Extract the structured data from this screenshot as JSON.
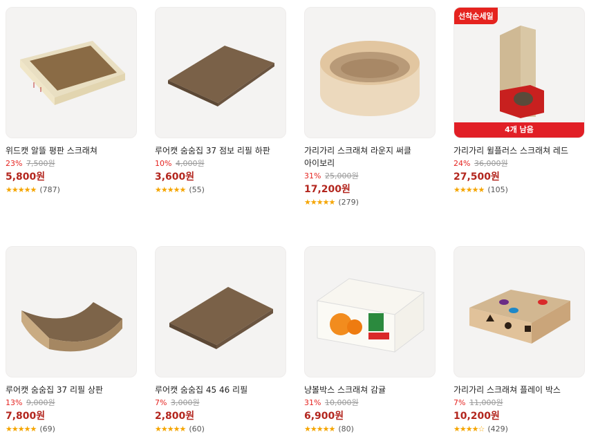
{
  "products": [
    {
      "name": "위드캣 알뜰 평판 스크래쳐",
      "discount": "23%",
      "original_price": "7,500원",
      "price": "5,800원",
      "stars": "★★★★★",
      "reviews": "(787)",
      "rating": 5.0
    },
    {
      "name": "루어캣 숨숨집 37 점보 리필 하판",
      "discount": "10%",
      "original_price": "4,000원",
      "price": "3,600원",
      "stars": "★★★★★",
      "reviews": "(55)",
      "rating": 5.0
    },
    {
      "name": "가리가리 스크래쳐 라운지 써클 아이보리",
      "discount": "31%",
      "original_price": "25,000원",
      "price": "17,200원",
      "stars": "★★★★★",
      "reviews": "(279)",
      "rating": 5.0
    },
    {
      "name": "가리가리 윌플러스 스크래쳐 레드",
      "discount": "24%",
      "original_price": "36,000원",
      "price": "27,500원",
      "stars": "★★★★★",
      "reviews": "(105)",
      "rating": 5.0,
      "badge": "선착순세일",
      "stock": "4개 남음"
    },
    {
      "name": "루어캣 숨숨집 37 리필 상판",
      "discount": "13%",
      "original_price": "9,000원",
      "price": "7,800원",
      "stars": "★★★★★",
      "reviews": "(69)",
      "rating": 5.0
    },
    {
      "name": "루어캣 숨숨집 45 46 리필",
      "discount": "7%",
      "original_price": "3,000원",
      "price": "2,800원",
      "stars": "★★★★★",
      "reviews": "(60)",
      "rating": 5.0
    },
    {
      "name": "냥볼박스 스크래쳐 감귤",
      "discount": "31%",
      "original_price": "10,000원",
      "price": "6,900원",
      "stars": "★★★★★",
      "reviews": "(80)",
      "rating": 5.0
    },
    {
      "name": "가리가리 스크래쳐 플레이 박스",
      "discount": "7%",
      "original_price": "11,000원",
      "price": "10,200원",
      "stars": "★★★★☆",
      "reviews": "(429)",
      "rating": 4.5
    }
  ],
  "colors": {
    "discount": "#e5231f",
    "price": "#b3261e",
    "star": "#f5a500",
    "badge_bg": "#e5231f"
  }
}
